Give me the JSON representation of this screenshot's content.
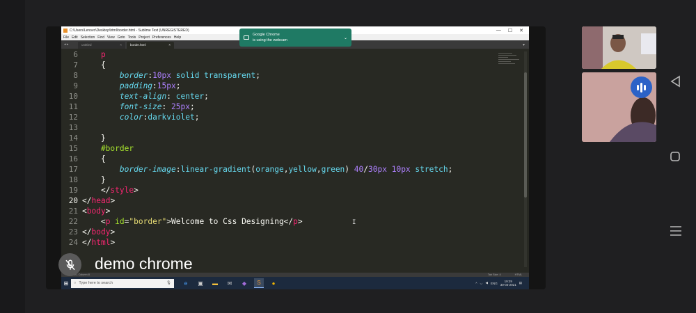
{
  "window": {
    "title": "C:\\Users\\Lenovo\\Desktop\\html\\border.html - Sublime Text (UNREGISTERED)",
    "controls": [
      "—",
      "☐",
      "✕"
    ]
  },
  "menu": [
    "File",
    "Edit",
    "Selection",
    "Find",
    "View",
    "Goto",
    "Tools",
    "Project",
    "Preferences",
    "Help"
  ],
  "tabs": [
    {
      "label": "untitled",
      "close": "×",
      "active": false
    },
    {
      "label": "border.html",
      "close": "×",
      "active": true
    }
  ],
  "notification": {
    "title": "Google Chrome",
    "message": "is using the webcam"
  },
  "editor": {
    "current_line": 20,
    "lines": [
      {
        "n": "6",
        "segs": [
          {
            "c": "kw-tag",
            "t": "    p"
          }
        ]
      },
      {
        "n": "7",
        "segs": [
          {
            "c": "plain",
            "t": "    {"
          }
        ]
      },
      {
        "n": "8",
        "segs": [
          {
            "c": "plain",
            "t": "        "
          },
          {
            "c": "prop",
            "t": "border"
          },
          {
            "c": "plain",
            "t": ":"
          },
          {
            "c": "num",
            "t": "10px"
          },
          {
            "c": "val",
            "t": " solid transparent"
          },
          {
            "c": "plain",
            "t": ";"
          }
        ]
      },
      {
        "n": "9",
        "segs": [
          {
            "c": "plain",
            "t": "        "
          },
          {
            "c": "prop",
            "t": "padding"
          },
          {
            "c": "plain",
            "t": ":"
          },
          {
            "c": "num",
            "t": "15px"
          },
          {
            "c": "plain",
            "t": ";"
          }
        ]
      },
      {
        "n": "10",
        "segs": [
          {
            "c": "plain",
            "t": "        "
          },
          {
            "c": "prop",
            "t": "text-align"
          },
          {
            "c": "plain",
            "t": ": "
          },
          {
            "c": "val",
            "t": "center"
          },
          {
            "c": "plain",
            "t": ";"
          }
        ]
      },
      {
        "n": "11",
        "segs": [
          {
            "c": "plain",
            "t": "        "
          },
          {
            "c": "prop",
            "t": "font-size"
          },
          {
            "c": "plain",
            "t": ": "
          },
          {
            "c": "num",
            "t": "25px"
          },
          {
            "c": "plain",
            "t": ";"
          }
        ]
      },
      {
        "n": "12",
        "segs": [
          {
            "c": "plain",
            "t": "        "
          },
          {
            "c": "prop",
            "t": "color"
          },
          {
            "c": "plain",
            "t": ":"
          },
          {
            "c": "val",
            "t": "darkviolet"
          },
          {
            "c": "plain",
            "t": ";"
          }
        ]
      },
      {
        "n": "13",
        "segs": []
      },
      {
        "n": "14",
        "segs": [
          {
            "c": "plain",
            "t": "    }"
          }
        ]
      },
      {
        "n": "15",
        "segs": [
          {
            "c": "attr",
            "t": "    #border"
          }
        ]
      },
      {
        "n": "16",
        "segs": [
          {
            "c": "plain",
            "t": "    {"
          }
        ]
      },
      {
        "n": "17",
        "segs": [
          {
            "c": "plain",
            "t": "        "
          },
          {
            "c": "prop",
            "t": "border-image"
          },
          {
            "c": "plain",
            "t": ":"
          },
          {
            "c": "val",
            "t": "linear-gradient"
          },
          {
            "c": "plain",
            "t": "("
          },
          {
            "c": "val",
            "t": "orange"
          },
          {
            "c": "plain",
            "t": ","
          },
          {
            "c": "val",
            "t": "yellow"
          },
          {
            "c": "plain",
            "t": ","
          },
          {
            "c": "val",
            "t": "green"
          },
          {
            "c": "plain",
            "t": ") "
          },
          {
            "c": "num",
            "t": "40"
          },
          {
            "c": "plain",
            "t": "/"
          },
          {
            "c": "num",
            "t": "30px"
          },
          {
            "c": "plain",
            "t": " "
          },
          {
            "c": "num",
            "t": "10px"
          },
          {
            "c": "val",
            "t": " stretch"
          },
          {
            "c": "plain",
            "t": ";"
          }
        ]
      },
      {
        "n": "18",
        "segs": [
          {
            "c": "plain",
            "t": "    }"
          }
        ]
      },
      {
        "n": "19",
        "segs": [
          {
            "c": "plain",
            "t": "    </"
          },
          {
            "c": "kw-tag",
            "t": "style"
          },
          {
            "c": "plain",
            "t": ">"
          }
        ]
      },
      {
        "n": "20",
        "segs": [
          {
            "c": "plain",
            "t": "</"
          },
          {
            "c": "kw-tag",
            "t": "head"
          },
          {
            "c": "plain",
            "t": ">"
          }
        ]
      },
      {
        "n": "21",
        "segs": [
          {
            "c": "plain",
            "t": "<"
          },
          {
            "c": "kw-tag",
            "t": "body"
          },
          {
            "c": "plain",
            "t": ">"
          }
        ]
      },
      {
        "n": "22",
        "segs": [
          {
            "c": "plain",
            "t": "    <"
          },
          {
            "c": "kw-tag",
            "t": "p"
          },
          {
            "c": "attr",
            "t": " id"
          },
          {
            "c": "plain",
            "t": "="
          },
          {
            "c": "str",
            "t": "\"border\""
          },
          {
            "c": "plain",
            "t": ">Welcome to Css Designing</"
          },
          {
            "c": "kw-tag",
            "t": "p"
          },
          {
            "c": "plain",
            "t": ">"
          }
        ]
      },
      {
        "n": "23",
        "segs": [
          {
            "c": "plain",
            "t": "</"
          },
          {
            "c": "kw-tag",
            "t": "body"
          },
          {
            "c": "plain",
            "t": ">"
          }
        ]
      },
      {
        "n": "24",
        "segs": [
          {
            "c": "plain",
            "t": "</"
          },
          {
            "c": "kw-tag",
            "t": "html"
          },
          {
            "c": "plain",
            "t": ">"
          }
        ]
      }
    ]
  },
  "statusbar": {
    "left": "Line 20, Column 8",
    "tab_size": "Tab Size: 4",
    "syntax": "HTML"
  },
  "taskbar": {
    "search_placeholder": "Type here to search",
    "tray_lang": "ENG",
    "time": "19:29",
    "date": "30-04-2021"
  },
  "meeting": {
    "presenter_name": "demo chrome",
    "speaking_icon": "audio-bars-icon",
    "mic_icon": "mic-off-icon"
  },
  "colors": {
    "editor_bg": "#282923",
    "notification_bg": "#1f7a64",
    "speaking_badge": "#2c62c7"
  }
}
